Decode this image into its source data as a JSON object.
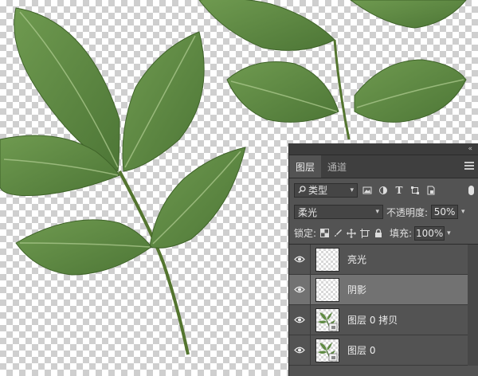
{
  "panel": {
    "collapse_glyph": "«",
    "tabs": [
      {
        "label": "图层",
        "active": true
      },
      {
        "label": "通道",
        "active": false
      }
    ],
    "filter": {
      "label": "类型",
      "icon": "search-icon"
    },
    "filter_icons": [
      "image-filter-icon",
      "adjustment-filter-icon",
      "type-filter-icon",
      "shape-filter-icon",
      "smart-object-filter-icon"
    ],
    "blend_mode": "柔光",
    "opacity_label": "不透明度:",
    "opacity_value": "50%",
    "lock_label": "锁定:",
    "fill_label": "填充:",
    "fill_value": "100%",
    "layers": [
      {
        "name": "亮光",
        "visible": true,
        "selected": false,
        "thumb": "blank"
      },
      {
        "name": "阴影",
        "visible": true,
        "selected": true,
        "thumb": "blank"
      },
      {
        "name": "图层 0 拷贝",
        "visible": true,
        "selected": false,
        "thumb": "leaf"
      },
      {
        "name": "图层 0",
        "visible": true,
        "selected": false,
        "thumb": "leaf"
      }
    ]
  },
  "colors": {
    "panel_bg": "#535353",
    "selected_row": "#727272",
    "leaf_green": "#5f8a43"
  }
}
